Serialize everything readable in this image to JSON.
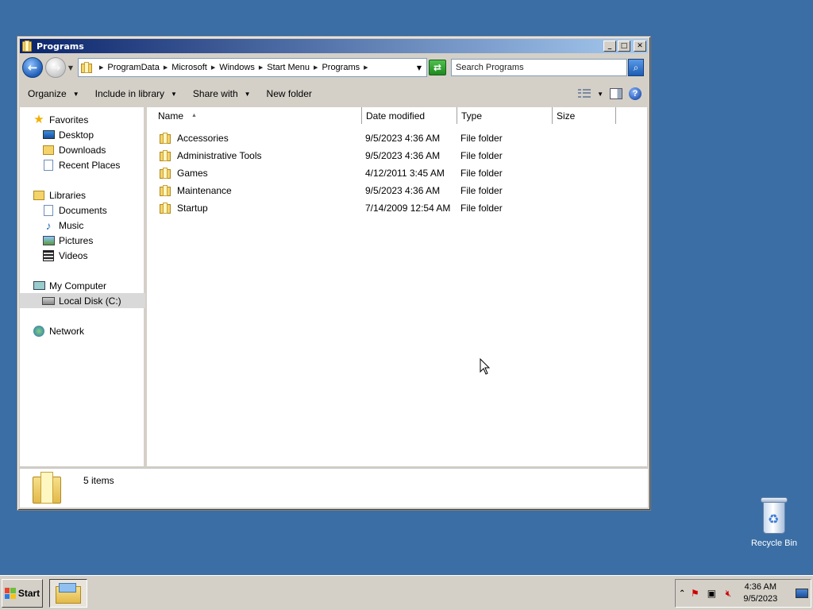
{
  "window": {
    "title": "Programs",
    "controls": {
      "minimize": "_",
      "maximize": "□",
      "close": "✕"
    }
  },
  "address": {
    "breadcrumbs": [
      "ProgramData",
      "Microsoft",
      "Windows",
      "Start Menu",
      "Programs"
    ],
    "search_placeholder": "Search Programs"
  },
  "toolbar": {
    "organize": "Organize",
    "include_in_library": "Include in library",
    "share_with": "Share with",
    "new_folder": "New folder"
  },
  "nav": {
    "favorites": {
      "label": "Favorites",
      "items": [
        "Desktop",
        "Downloads",
        "Recent Places"
      ]
    },
    "libraries": {
      "label": "Libraries",
      "items": [
        "Documents",
        "Music",
        "Pictures",
        "Videos"
      ]
    },
    "computer": {
      "label": "My Computer",
      "items": [
        "Local Disk (C:)"
      ]
    },
    "network": {
      "label": "Network"
    }
  },
  "columns": {
    "name": "Name",
    "date": "Date modified",
    "type": "Type",
    "size": "Size"
  },
  "files": [
    {
      "name": "Accessories",
      "date": "9/5/2023 4:36 AM",
      "type": "File folder"
    },
    {
      "name": "Administrative Tools",
      "date": "9/5/2023 4:36 AM",
      "type": "File folder"
    },
    {
      "name": "Games",
      "date": "4/12/2011 3:45 AM",
      "type": "File folder"
    },
    {
      "name": "Maintenance",
      "date": "9/5/2023 4:36 AM",
      "type": "File folder"
    },
    {
      "name": "Startup",
      "date": "7/14/2009 12:54 AM",
      "type": "File folder"
    }
  ],
  "details": {
    "item_count": "5 items"
  },
  "desktop": {
    "recycle_bin": "Recycle Bin"
  },
  "taskbar": {
    "start": "Start",
    "time": "4:36 AM",
    "date": "9/5/2023"
  }
}
